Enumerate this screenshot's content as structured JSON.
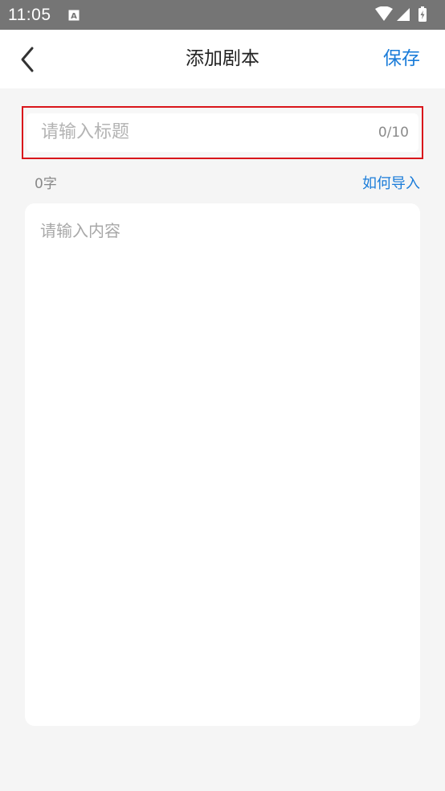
{
  "status_bar": {
    "time": "11:05",
    "icons": [
      "accessibility-a-icon",
      "wifi-icon",
      "signal-icon",
      "battery-icon"
    ]
  },
  "app_bar": {
    "back_icon": "chevron-left-icon",
    "title": "添加剧本",
    "save_label": "保存"
  },
  "title_field": {
    "placeholder": "请输入标题",
    "counter": "0/10"
  },
  "meta": {
    "char_count": "0字",
    "import_link": "如何导入"
  },
  "content_field": {
    "placeholder": "请输入内容"
  },
  "colors": {
    "accent": "#1a7cd9",
    "highlight_border": "#d9161b",
    "status_bar": "#757575",
    "background": "#f5f5f5"
  }
}
